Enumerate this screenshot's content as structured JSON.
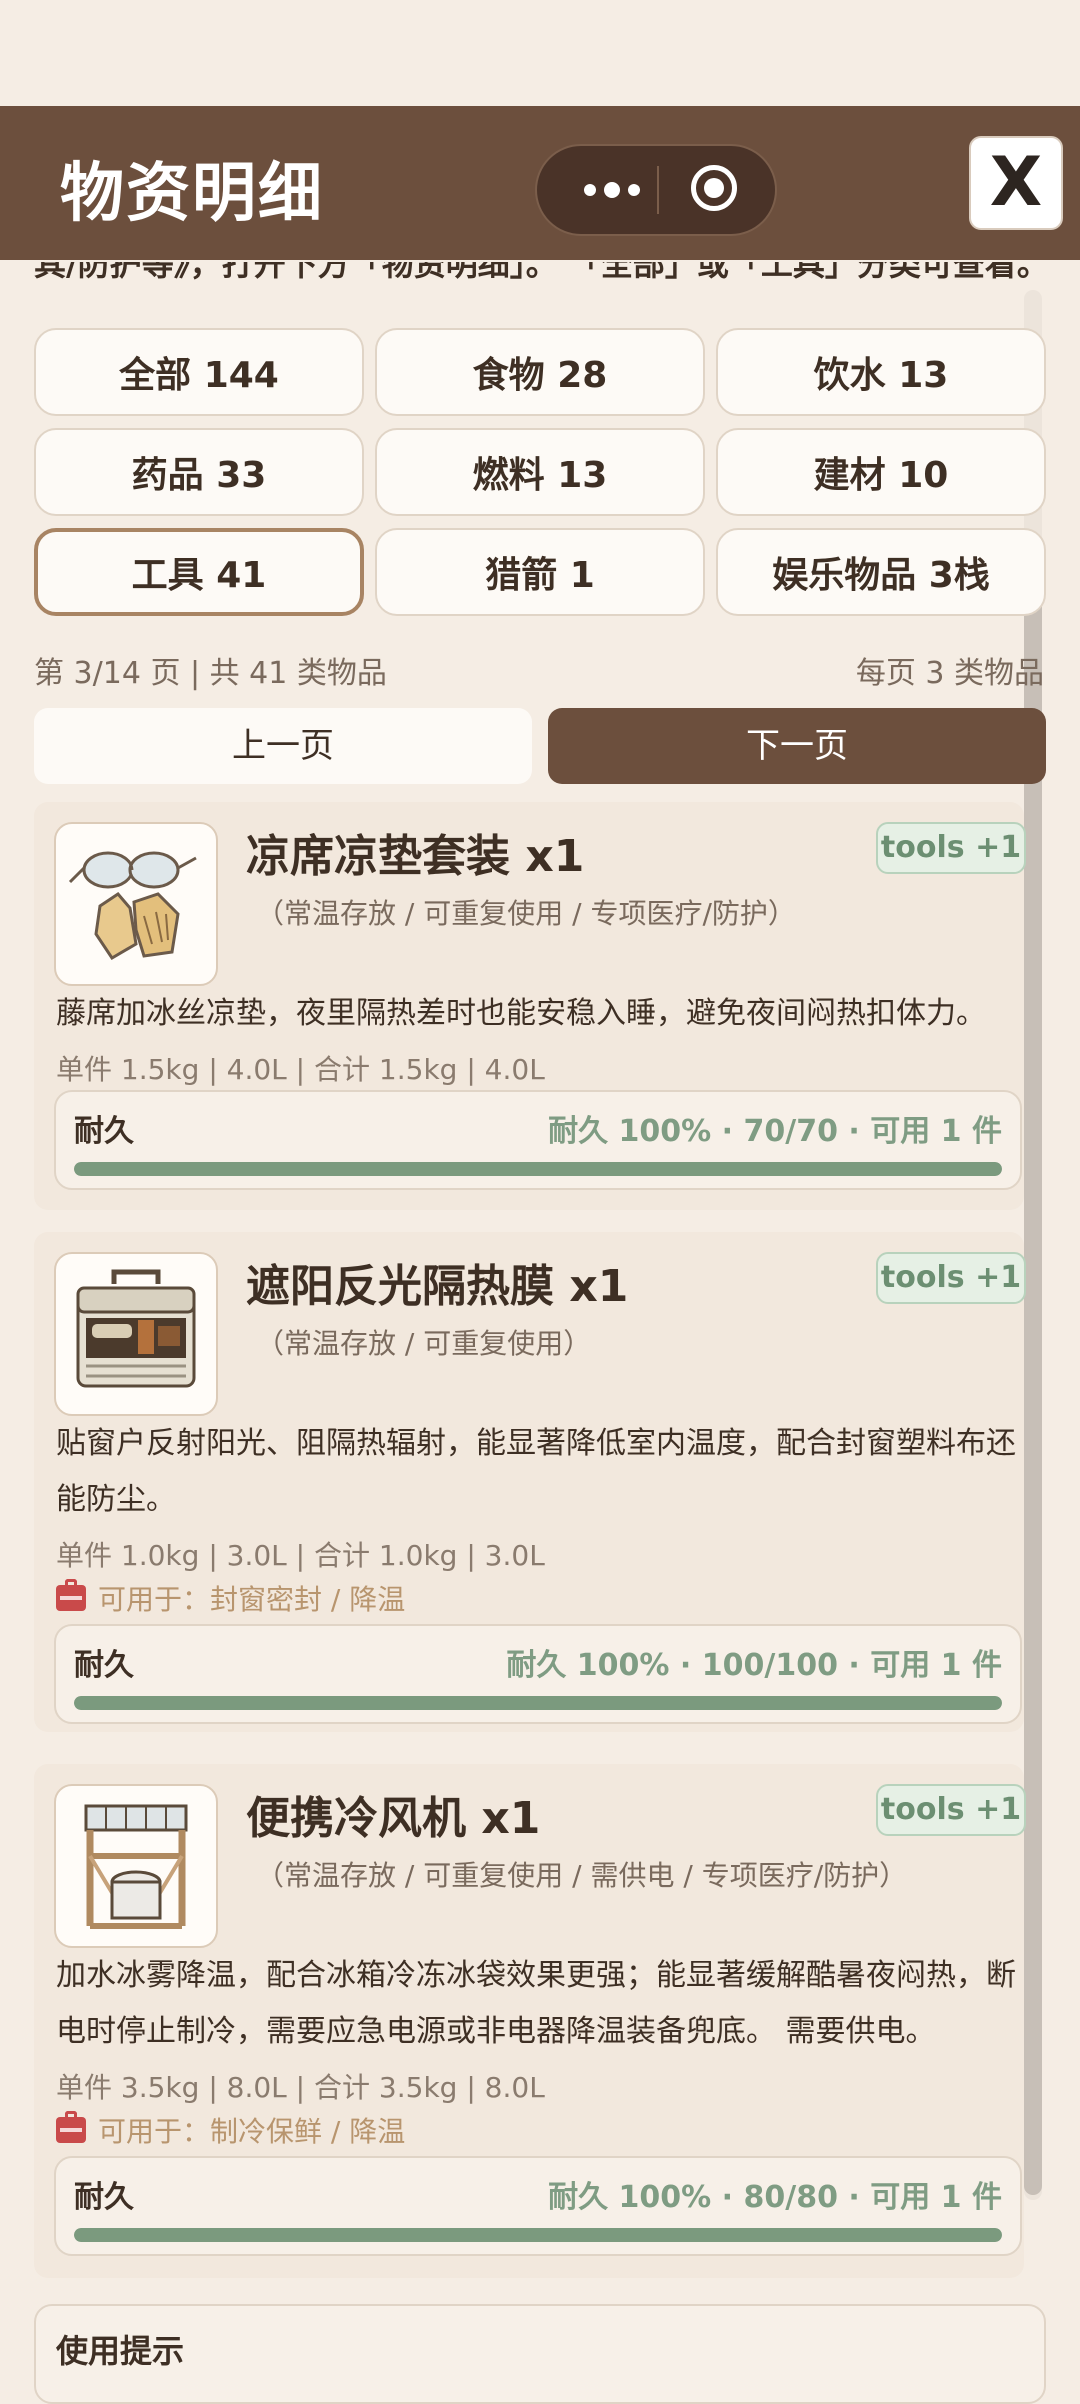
{
  "header": {
    "title": "物资明细",
    "close_label": "X"
  },
  "cutoff_text": "其/防护等》，打开下方「物资明细」。 「全部」或「工具」分类可查看。",
  "filters": [
    {
      "label": "全部 144",
      "active": false
    },
    {
      "label": "食物 28",
      "active": false
    },
    {
      "label": "饮水 13",
      "active": false
    },
    {
      "label": "药品 33",
      "active": false
    },
    {
      "label": "燃料 13",
      "active": false
    },
    {
      "label": "建材 10",
      "active": false
    },
    {
      "label": "工具 41",
      "active": true
    },
    {
      "label": "猎箭 1",
      "active": false
    },
    {
      "label": "娱乐物品 3栈",
      "active": false
    }
  ],
  "pagination": {
    "info": "第 3/14 页 | 共 41 类物品",
    "per_page": "每页 3 类物品",
    "prev_label": "上一页",
    "next_label": "下一页"
  },
  "items": [
    {
      "name": "凉席凉垫套装 x1",
      "tag": "tools +1",
      "attrs": "（常温存放 / 可重复使用 / 专项医疗/防护）",
      "desc": "藤席加冰丝凉垫，夜里隔热差时也能安稳入睡，避免夜间闷热扣体力。",
      "weight": "单件 1.5kg | 4.0L | 合计 1.5kg | 4.0L",
      "usage": "",
      "durability_label": "耐久",
      "durability_value": "耐久 100% · 70/70 · 可用 1 件",
      "durability_fraction": 1.0,
      "icon": "goggles-gloves-icon"
    },
    {
      "name": "遮阳反光隔热膜 x1",
      "tag": "tools +1",
      "attrs": "（常温存放 / 可重复使用）",
      "desc": "贴窗户反射阳光、阻隔热辐射，能显著降低室内温度，配合封窗塑料布还能防尘。",
      "weight": "单件 1.0kg | 3.0L | 合计 1.0kg | 3.0L",
      "usage": "可用于：封窗密封 / 降温",
      "durability_label": "耐久",
      "durability_value": "耐久 100% · 100/100 · 可用 1 件",
      "durability_fraction": 1.0,
      "icon": "toolbox-icon"
    },
    {
      "name": "便携冷风机 x1",
      "tag": "tools +1",
      "attrs": "（常温存放 / 可重复使用 / 需供电 / 专项医疗/防护）",
      "desc": "加水冰雾降温，配合冰箱冷冻冰袋效果更强；能显著缓解酷暑夜闷热，断电时停止制冷，需要应急电源或非电器降温装备兜底。 需要供电。",
      "weight": "单件 3.5kg | 8.0L | 合计 3.5kg | 8.0L",
      "usage": "可用于：制冷保鲜 / 降温",
      "durability_label": "耐久",
      "durability_value": "耐久 100% · 80/80 · 可用 1 件",
      "durability_fraction": 1.0,
      "icon": "solar-cooler-icon"
    }
  ],
  "tips": {
    "title": "使用提示"
  }
}
